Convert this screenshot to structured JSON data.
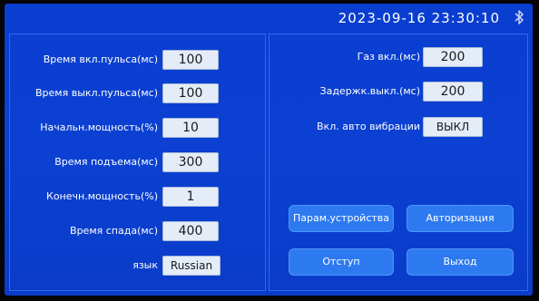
{
  "header": {
    "datetime": "2023-09-16 23:30:10",
    "bluetooth_icon": "bluetooth-icon"
  },
  "left_params": [
    {
      "label": "Время вкл.пульса(мс)",
      "value": "100"
    },
    {
      "label": "Время выкл.пульса(мс)",
      "value": "100"
    },
    {
      "label": "Начальн.мощность(%)",
      "value": "10"
    },
    {
      "label": "Время подъема(мс)",
      "value": "300"
    },
    {
      "label": "Конечн.мощность(%)",
      "value": "1"
    },
    {
      "label": "Время спада(мс)",
      "value": "400"
    },
    {
      "label": "язык",
      "value": "Russian"
    }
  ],
  "right_params": [
    {
      "label": "Газ вкл.(мс)",
      "value": "200"
    },
    {
      "label": "Задержк.выкл.(мс)",
      "value": "200"
    },
    {
      "label": "Вкл. авто вибрации",
      "value": "ВЫКЛ"
    }
  ],
  "buttons": {
    "device_params": "Парам.устройства",
    "authorization": "Авторизация",
    "indent": "Отступ",
    "exit": "Выход"
  },
  "colors": {
    "background": "#0b3fcf",
    "button": "#2d7af0",
    "field": "#e4ecf8"
  }
}
